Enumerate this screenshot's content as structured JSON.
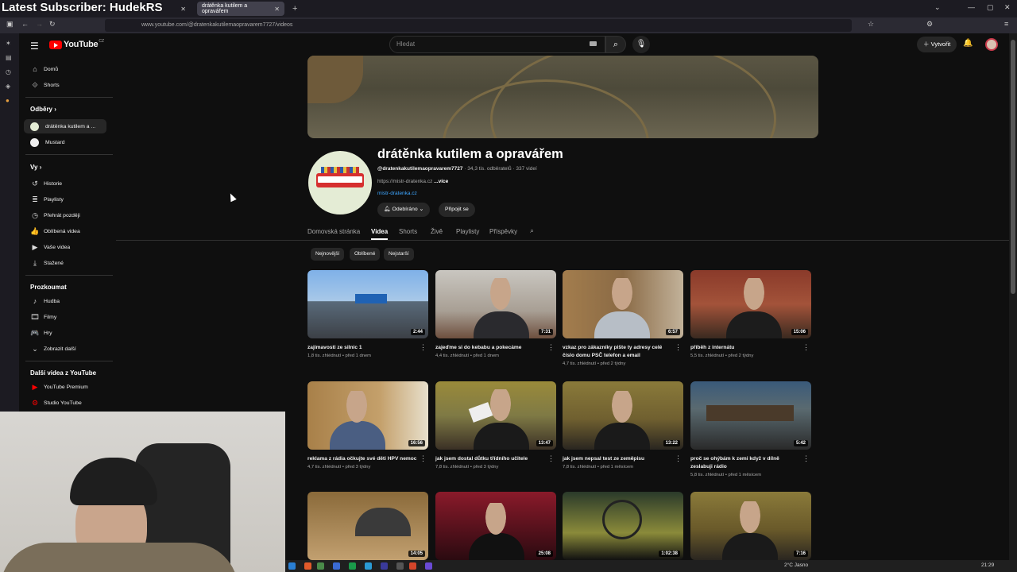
{
  "overlay_title": "Latest Subscriber: HudekRS",
  "browser": {
    "tabs": [
      {
        "label": "drátěnka kutilem a opravářem"
      }
    ],
    "url": "www.youtube.com/@dratenkakutilemaopravarem7727/videos",
    "new_tab": "+"
  },
  "youtube": {
    "logo_text": "YouTube",
    "logo_cc": "CZ",
    "search_placeholder": "Hledat",
    "create_label": "Vytvořit"
  },
  "sidebar": {
    "main": [
      {
        "label": "Domů",
        "icon": "home-icon"
      },
      {
        "label": "Shorts",
        "icon": "shorts-icon"
      }
    ],
    "subs_heading": "Odběry",
    "subs": [
      {
        "label": "drátěnka kutilem a ...",
        "selected": true
      },
      {
        "label": "Mustard"
      }
    ],
    "you_heading": "Vy",
    "you": [
      {
        "label": "Historie"
      },
      {
        "label": "Playlisty"
      },
      {
        "label": "Přehrát později"
      },
      {
        "label": "Oblíbená videa"
      },
      {
        "label": "Vaše videa"
      },
      {
        "label": "Stažené"
      }
    ],
    "explore_heading": "Prozkoumat",
    "explore": [
      {
        "label": "Hudba"
      },
      {
        "label": "Filmy"
      },
      {
        "label": "Hry"
      },
      {
        "label": "Zobrazit další"
      }
    ],
    "more_heading": "Další videa z YouTube",
    "more": [
      {
        "label": "YouTube Premium"
      },
      {
        "label": "Studio YouTube"
      }
    ]
  },
  "channel": {
    "name": "drátěnka kutilem a opravářem",
    "handle": "@dratenkakutilemaopravarem7727",
    "subscribers": "34,3 tis. odběratelů",
    "videos_count": "337 videí",
    "link": "https://mistr-dratenka.cz",
    "more": "...více",
    "link2": "mistr-dratenka.cz",
    "subscribed_label": "Odebíráno",
    "join_label": "Připojit se"
  },
  "channel_tabs": [
    "Domovská stránka",
    "Videa",
    "Shorts",
    "Živě",
    "Playlisty",
    "Příspěvky"
  ],
  "chips": [
    "Nejnovější",
    "Oblíbené",
    "Nejstarší"
  ],
  "videos": [
    {
      "title": "zajímavosti ze silnic 1",
      "meta": "1,8 tis. zhlédnutí • před 1 dnem",
      "duration": "2:44"
    },
    {
      "title": "zajeďme si do kebabu a pokecáme",
      "meta": "4,4 tis. zhlédnutí • před 1 dnem",
      "duration": "7:31"
    },
    {
      "title": "vzkaz pro zákazníky pište ty adresy celé číslo domu PSČ telefon a email",
      "meta": "4,7 tis. zhlédnutí • před 2 týdny",
      "duration": "6:57"
    },
    {
      "title": "příběh z internátu",
      "meta": "5,5 tis. zhlédnutí • před 2 týdny",
      "duration": "15:06"
    },
    {
      "title": "reklama z rádia očkujte své děti HPV nemoc",
      "meta": "4,7 tis. zhlédnutí • před 3 týdny",
      "duration": "16:56"
    },
    {
      "title": "jak jsem dostal důtku třídního učitele",
      "meta": "7,8 tis. zhlédnutí • před 3 týdny",
      "duration": "13:47"
    },
    {
      "title": "jak jsem nepsal test ze zeměpisu",
      "meta": "7,8 tis. zhlédnutí • před 1 měsícem",
      "duration": "13:22"
    },
    {
      "title": "proč se ohýbám k zemi když v dílně zeslabuji rádio",
      "meta": "5,8 tis. zhlédnutí • před 1 měsícem",
      "duration": "5:42"
    },
    {
      "title": "",
      "meta": "",
      "duration": "14:05"
    },
    {
      "title": "",
      "meta": "",
      "duration": "25:08"
    },
    {
      "title": "",
      "meta": "",
      "duration": "1:02:38"
    },
    {
      "title": "",
      "meta": "",
      "duration": "7:16"
    }
  ],
  "taskbar": {
    "weather": "2°C Jasno",
    "time": "21:29"
  }
}
